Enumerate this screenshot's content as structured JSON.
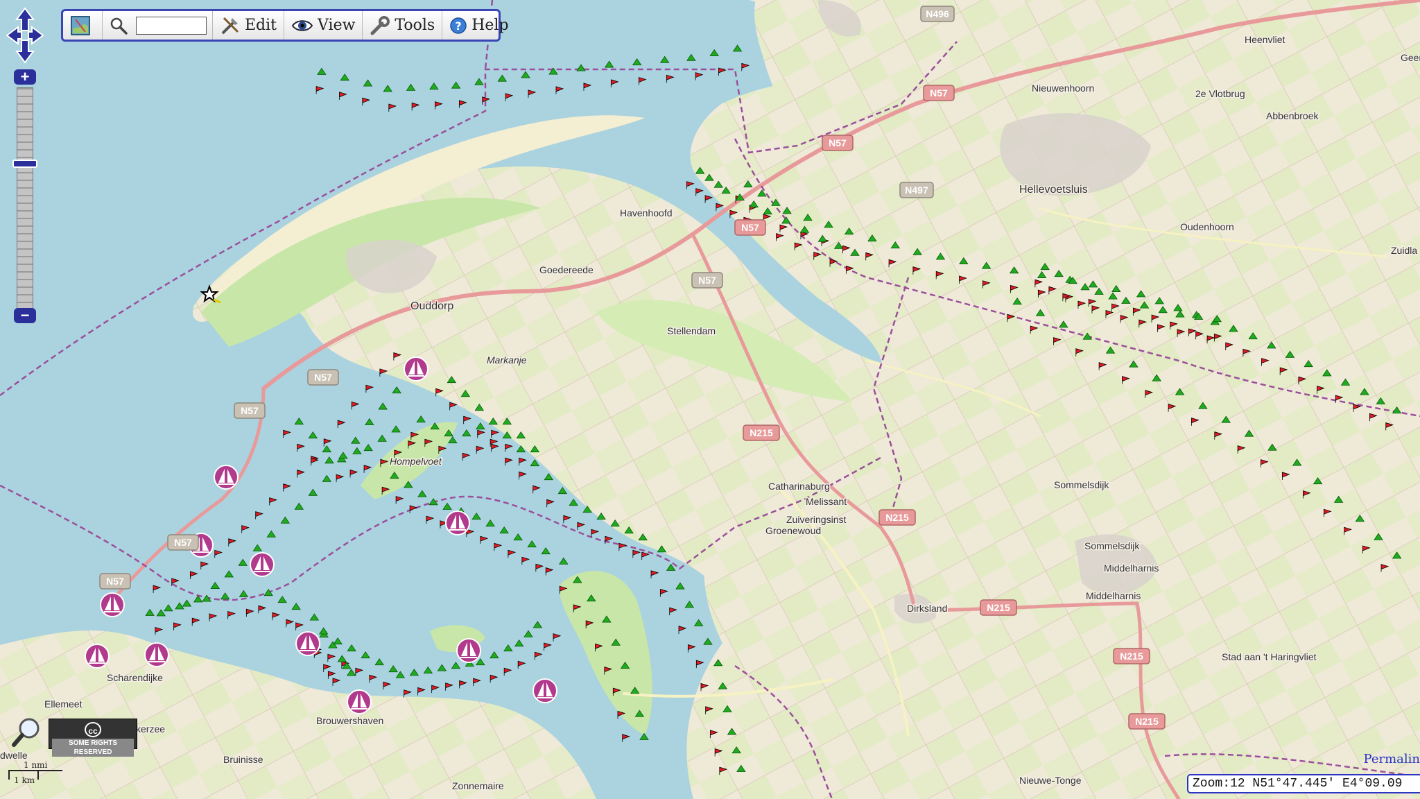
{
  "toolbar": {
    "edit": "Edit",
    "view": "View",
    "tools": "Tools",
    "help": "Help",
    "search_value": ""
  },
  "zoom": {
    "plus": "+",
    "minus": "−"
  },
  "license": {
    "cc": "cc",
    "text": "SOME RIGHTS RESERVED"
  },
  "scale": {
    "nautical": "1 nmi",
    "km": "1 km"
  },
  "permalink": "Permalin",
  "status": {
    "coords": "Zoom:12 N51°47.445' E4°09.09"
  },
  "places": [
    {
      "name": "Heenvliet"
    },
    {
      "name": "Geer"
    },
    {
      "name": "Nieuwenhoorn"
    },
    {
      "name": "2e Vlotbrug"
    },
    {
      "name": "Abbenbroek"
    },
    {
      "name": "Hellevoetsluis"
    },
    {
      "name": "Oudenhoorn"
    },
    {
      "name": "Zuidla"
    },
    {
      "name": "Havenhoofd"
    },
    {
      "name": "Goedereede"
    },
    {
      "name": "Ouddorp"
    },
    {
      "name": "Stellendam"
    },
    {
      "name": "Markanje"
    },
    {
      "name": "Hompelvoet"
    },
    {
      "name": "Catharinaburg"
    },
    {
      "name": "Melissant"
    },
    {
      "name": "Zuiveringsinst"
    },
    {
      "name": "Groenewoud"
    },
    {
      "name": "Sommelsdijk"
    },
    {
      "name": "Sommelsdijk"
    },
    {
      "name": "Middelharnis"
    },
    {
      "name": "Middelharnis"
    },
    {
      "name": "Dirksland"
    },
    {
      "name": "Stad aan 't Haringvliet"
    },
    {
      "name": "Scharendijke"
    },
    {
      "name": "Ellemeet"
    },
    {
      "name": "Brouwershaven"
    },
    {
      "name": "Bruinisse"
    },
    {
      "name": "Zonnemaire"
    },
    {
      "name": "Nieuwe-Tonge"
    },
    {
      "name": "kerzee"
    },
    {
      "name": "dwelle"
    }
  ],
  "roads": [
    {
      "label": "N496"
    },
    {
      "label": "N57"
    },
    {
      "label": "N57"
    },
    {
      "label": "N497"
    },
    {
      "label": "N57"
    },
    {
      "label": "N57"
    },
    {
      "label": "N57"
    },
    {
      "label": "N57"
    },
    {
      "label": "N57"
    },
    {
      "label": "N57"
    },
    {
      "label": "N215"
    },
    {
      "label": "N215"
    },
    {
      "label": "N215"
    },
    {
      "label": "N215"
    },
    {
      "label": "N215"
    }
  ],
  "colors": {
    "water": "#aad3df",
    "land": "#f2efe9",
    "farmland": "#e8ecd0",
    "green": "#c8e6a8",
    "buoy_red": "#e11b22",
    "buoy_green": "#1faa1f",
    "border": "#9b4f9b",
    "harbour": "#b23a8c",
    "accent": "#2b34c4"
  }
}
